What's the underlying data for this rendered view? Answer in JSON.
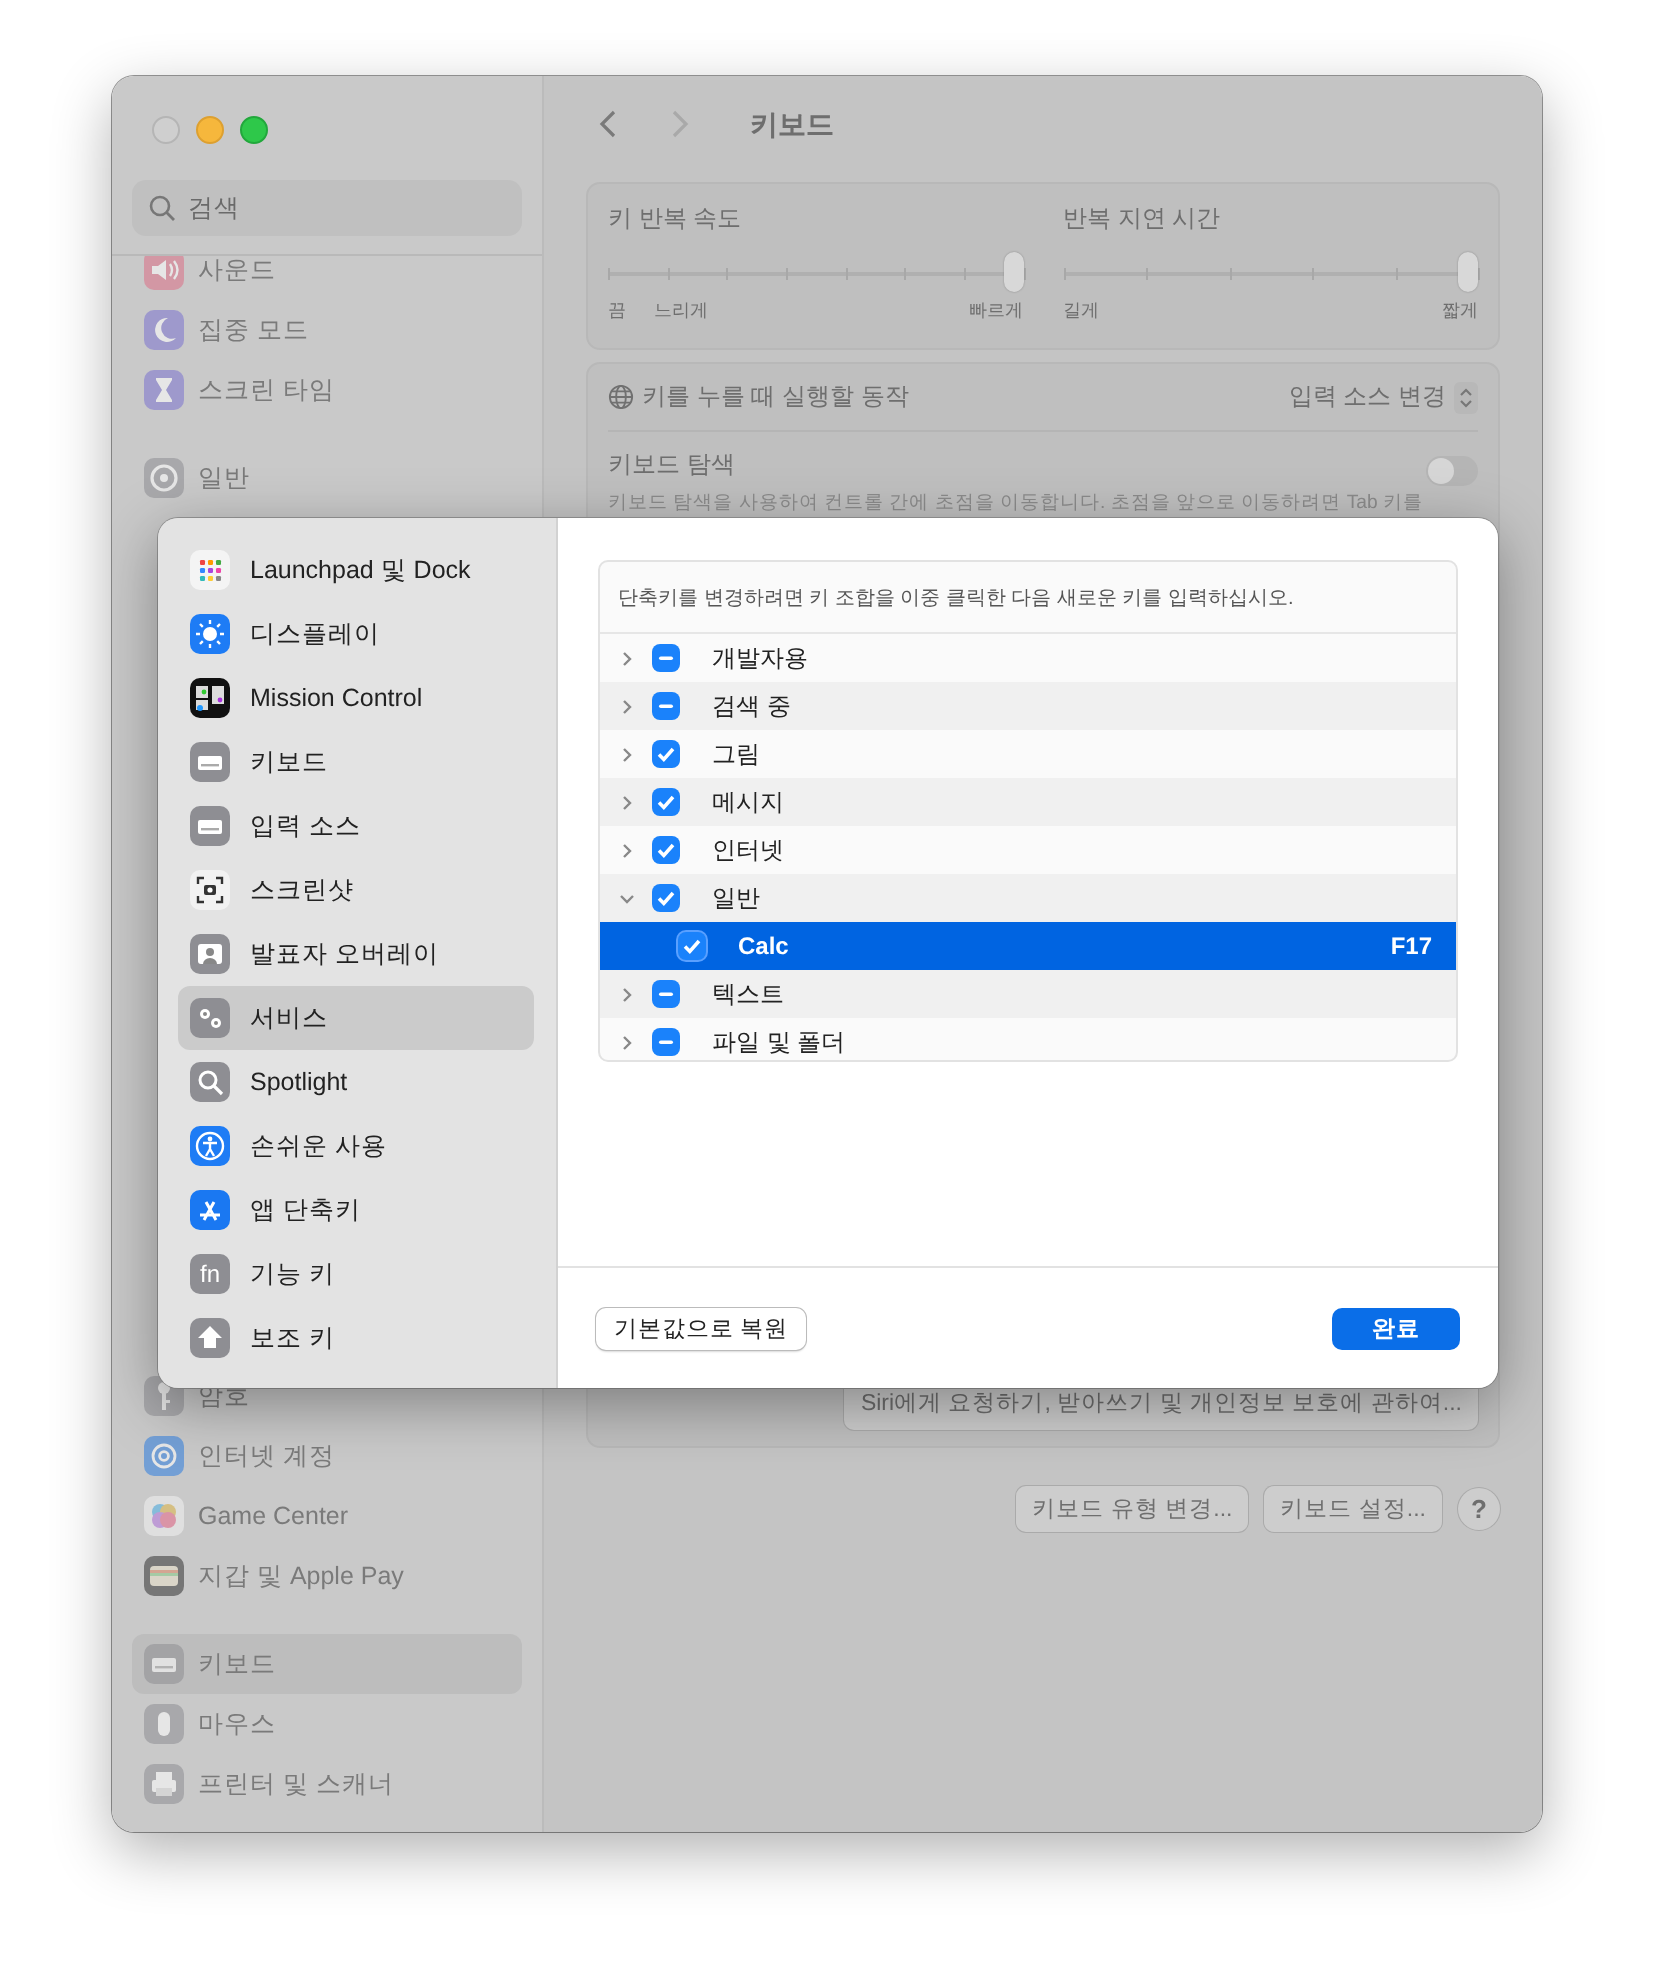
{
  "window": {
    "back": {
      "disabled": false
    },
    "forward": {
      "disabled": true
    },
    "title": "키보드"
  },
  "sidebar": {
    "search": {
      "placeholder": "검색"
    },
    "sections": [
      {
        "items": [
          {
            "label": "사운드",
            "selected": false
          },
          {
            "label": "집중 모드",
            "selected": false
          },
          {
            "label": "스크린 타임",
            "selected": false
          }
        ]
      },
      {
        "items": [
          {
            "label": "일반",
            "selected": false
          }
        ]
      },
      {
        "items": [
          {
            "label": "암호",
            "selected": false
          },
          {
            "label": "인터넷 계정",
            "selected": false
          },
          {
            "label": "Game Center",
            "selected": false
          },
          {
            "label": "지갑 및 Apple Pay",
            "selected": false
          }
        ]
      },
      {
        "items": [
          {
            "label": "키보드",
            "selected": true
          },
          {
            "label": "마우스",
            "selected": false
          },
          {
            "label": "프린터 및 스캐너",
            "selected": false
          }
        ]
      }
    ]
  },
  "pane": {
    "sliders": [
      {
        "label": "키 반복 속도",
        "level": 1,
        "marks": [
          "끔",
          "느리게",
          "빠르게"
        ]
      },
      {
        "label": "반복 지연 시간",
        "level": 1,
        "marks": [
          "길게",
          "짧게"
        ]
      }
    ],
    "globe_key": {
      "label": "키를 누를 때 실행할 동작",
      "value": "입력 소스 변경"
    },
    "keyboard_navigation": {
      "label": "키보드 탐색",
      "on": false,
      "description": "키보드 탐색을 사용하여 컨트롤 간에 초점을 이동합니다. 초점을 앞으로 이동하려면 Tab 키를"
    },
    "siri_button": "Siri에게 요청하기, 받아쓰기 및 개인정보 보호에 관하여...",
    "buttons": [
      "키보드 유형 변경...",
      "키보드 설정..."
    ],
    "help": "?"
  },
  "dialog": {
    "categories": [
      {
        "label": "Launchpad 및 Dock",
        "selected": false
      },
      {
        "label": "디스플레이",
        "selected": false
      },
      {
        "label": "Mission Control",
        "selected": false
      },
      {
        "label": "키보드",
        "selected": false
      },
      {
        "label": "입력 소스",
        "selected": false
      },
      {
        "label": "스크린샷",
        "selected": false
      },
      {
        "label": "발표자 오버레이",
        "selected": false
      },
      {
        "label": "서비스",
        "selected": true
      },
      {
        "label": "Spotlight",
        "selected": false
      },
      {
        "label": "손쉬운 사용",
        "selected": false
      },
      {
        "label": "앱 단축키",
        "selected": false
      },
      {
        "label": "기능 키",
        "selected": false,
        "icon_label": "fn"
      },
      {
        "label": "보조 키",
        "selected": false
      }
    ],
    "hint": "단축키를 변경하려면 키 조합을 이중 클릭한 다음 새로운 키를 입력하십시오.",
    "shortcuts": [
      {
        "label": "개발자용",
        "expanded": false,
        "checked": true,
        "mixed": true,
        "selected": false
      },
      {
        "label": "검색 중",
        "expanded": false,
        "checked": true,
        "mixed": true,
        "selected": false
      },
      {
        "label": "그림",
        "expanded": false,
        "checked": true,
        "mixed": false,
        "selected": false
      },
      {
        "label": "메시지",
        "expanded": false,
        "checked": true,
        "mixed": false,
        "selected": false
      },
      {
        "label": "인터넷",
        "expanded": false,
        "checked": true,
        "mixed": false,
        "selected": false
      },
      {
        "label": "일반",
        "expanded": true,
        "checked": true,
        "mixed": false,
        "selected": false,
        "children": [
          {
            "label": "Calc",
            "checked": true,
            "mixed": false,
            "selected": true,
            "shortcut": "F17"
          }
        ]
      },
      {
        "label": "텍스트",
        "expanded": false,
        "checked": true,
        "mixed": true,
        "selected": false
      },
      {
        "label": "파일 및 폴더",
        "expanded": false,
        "checked": true,
        "mixed": true,
        "selected": false
      }
    ],
    "buttons": [
      {
        "label": "기본값으로 복원",
        "default": false
      },
      {
        "label": "완료",
        "default": true
      }
    ]
  }
}
